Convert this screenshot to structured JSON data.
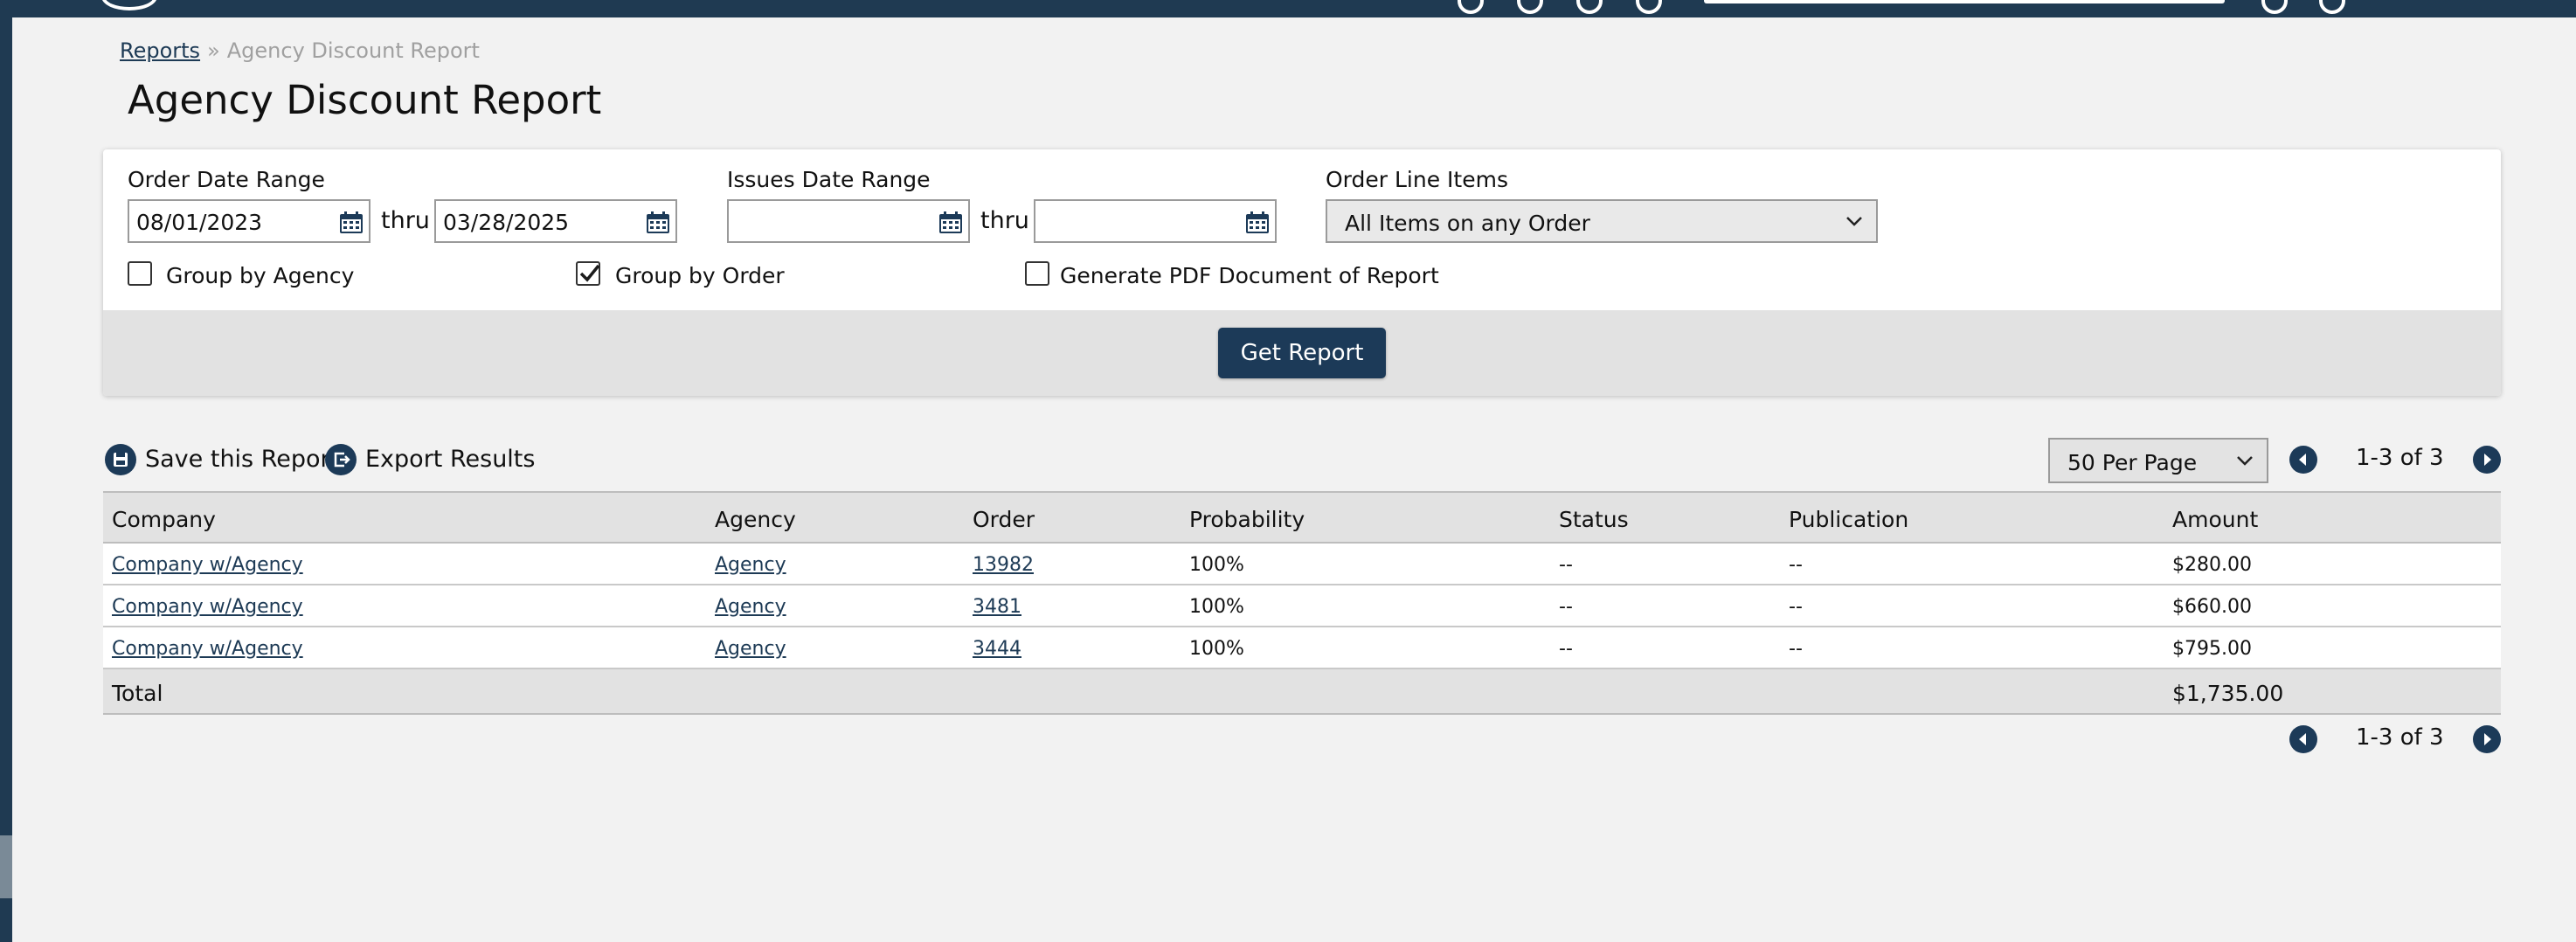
{
  "breadcrumb": {
    "parent": "Reports",
    "separator": "»",
    "current": "Agency Discount Report"
  },
  "page_title": "Agency Discount Report",
  "filters": {
    "order_date_range": {
      "label": "Order Date Range",
      "from": "08/01/2023",
      "thru_label": "thru",
      "to": "03/28/2025"
    },
    "issues_date_range": {
      "label": "Issues Date Range",
      "from": "",
      "thru_label": "thru",
      "to": ""
    },
    "order_line_items": {
      "label": "Order Line Items",
      "selected": "All Items on any Order"
    },
    "group_by_agency": {
      "label": "Group by Agency",
      "checked": false
    },
    "group_by_order": {
      "label": "Group by Order",
      "checked": true
    },
    "generate_pdf": {
      "label": "Generate PDF Document of Report",
      "checked": false
    },
    "submit_label": "Get Report"
  },
  "actions": {
    "save_label": "Save this Report",
    "export_label": "Export Results"
  },
  "pagination": {
    "per_page": "50 Per Page",
    "range_text": "1-3 of 3"
  },
  "table": {
    "columns": [
      "Company",
      "Agency",
      "Order",
      "Probability",
      "Status",
      "Publication",
      "Amount"
    ],
    "rows": [
      {
        "company": "Company w/Agency",
        "agency": "Agency",
        "order": "13982",
        "probability": "100%",
        "status": "--",
        "publication": "--",
        "amount": "$280.00"
      },
      {
        "company": "Company w/Agency",
        "agency": "Agency",
        "order": "3481",
        "probability": "100%",
        "status": "--",
        "publication": "--",
        "amount": "$660.00"
      },
      {
        "company": "Company w/Agency",
        "agency": "Agency",
        "order": "3444",
        "probability": "100%",
        "status": "--",
        "publication": "--",
        "amount": "$795.00"
      }
    ],
    "total_label": "Total",
    "total_amount": "$1,735.00"
  },
  "colors": {
    "brand_navy": "#1c3a58",
    "header_bar": "#1f3a52",
    "link": "#1d3a55",
    "panel_footer": "#e2e2e2"
  }
}
